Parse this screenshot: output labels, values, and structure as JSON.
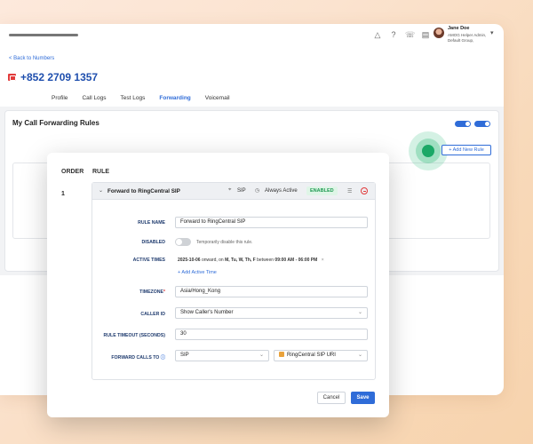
{
  "header": {
    "user_name": "Jane Doe",
    "user_role": "AMOG Helper Admin, Default Group,",
    "icons": [
      "alert-icon",
      "help-icon",
      "phone-icon",
      "contacts-icon"
    ]
  },
  "page": {
    "back_link": "< Back to Numbers",
    "phone_number": "+852 2709 1357",
    "tabs": [
      "Profile",
      "Call Logs",
      "Test Logs",
      "Forwarding",
      "Voicemail"
    ],
    "active_tab": "Forwarding",
    "section_title": "My Call Forwarding Rules",
    "add_rule_label": "+ Add New Rule"
  },
  "modal": {
    "col_order": "ORDER",
    "col_rule": "RULE",
    "order_num": "1",
    "rule_header": {
      "title": "Forward to RingCentral SIP",
      "sip": "SIP",
      "active": "Always Active",
      "status": "ENABLED"
    },
    "fields": {
      "rule_name_label": "RULE NAME",
      "rule_name_value": "Forward to RingCentral SIP",
      "disabled_label": "DISABLED",
      "disabled_hint": "Temporarily disable this rule.",
      "active_times_label": "ACTIVE TIMES",
      "active_time_prefix": "2025-10-06",
      "active_time_mid1": " onward, on ",
      "active_time_days": "M, Tu, W, Th, F",
      "active_time_mid2": " between ",
      "active_time_range": "09:00 AM - 06:00 PM",
      "active_time_remove": "×",
      "add_active_time": "+  Add Active Time",
      "timezone_label": "TIMEZONE",
      "timezone_required": "*",
      "timezone_value": "Asia/Hong_Kong",
      "caller_id_label": "CALLER ID",
      "caller_id_value": "Show Caller's Number",
      "timeout_label": "RULE TIMEOUT (SECONDS)",
      "timeout_value": "30",
      "forward_label": "FORWARD CALLS TO",
      "forward_info": "ⓘ",
      "forward_type": "SIP",
      "forward_target": "RingCentral SIP URI"
    },
    "cancel_label": "Cancel",
    "save_label": "Save"
  },
  "colors": {
    "accent": "#2f6cd8",
    "enabled": "#1f9a52",
    "danger": "#e23b3b",
    "pulse": "#1aa866"
  }
}
